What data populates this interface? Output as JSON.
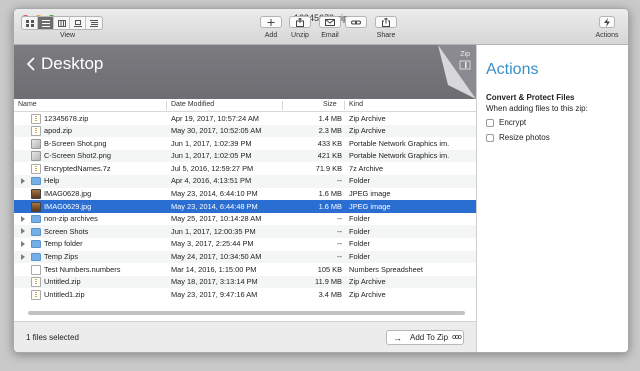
{
  "window": {
    "title": "12345678.zip"
  },
  "toolbar": {
    "view_label": "View",
    "add_label": "Add",
    "unzip_label": "Unzip",
    "email_label": "Email",
    "link_label": "",
    "share_label": "Share",
    "actions_label": "Actions"
  },
  "path": {
    "title": "Desktop",
    "archive_badge": "Zip"
  },
  "columns": {
    "name": "Name",
    "date": "Date Modified",
    "size": "Size",
    "kind": "Kind"
  },
  "files": [
    {
      "name": "12345678.zip",
      "date": "Apr 19, 2017, 10:57:24 AM",
      "size": "1.4 MB",
      "kind": "Zip Archive",
      "icon": "zip-icon",
      "expandable": false,
      "selected": false
    },
    {
      "name": "apod.zip",
      "date": "May 30, 2017, 10:52:05 AM",
      "size": "2.3 MB",
      "kind": "Zip Archive",
      "icon": "zip-icon",
      "expandable": false,
      "selected": false
    },
    {
      "name": "B-Screen Shot.png",
      "date": "Jun 1, 2017, 1:02:39 PM",
      "size": "433 KB",
      "kind": "Portable Network Graphics im.",
      "icon": "image-icon",
      "expandable": false,
      "selected": false
    },
    {
      "name": "C-Screen Shot2.png",
      "date": "Jun 1, 2017, 1:02:05 PM",
      "size": "421 KB",
      "kind": "Portable Network Graphics im.",
      "icon": "image-icon",
      "expandable": false,
      "selected": false
    },
    {
      "name": "EncryptedNames.7z",
      "date": "Jul 5, 2016, 12:59:27 PM",
      "size": "71.9 KB",
      "kind": "7z Archive",
      "icon": "zip-icon",
      "expandable": false,
      "selected": false
    },
    {
      "name": "Help",
      "date": "Apr 4, 2016, 4:13:51 PM",
      "size": "--",
      "kind": "Folder",
      "icon": "folder-icon",
      "expandable": true,
      "selected": false
    },
    {
      "name": "IMAG0628.jpg",
      "date": "May 23, 2014, 6:44:10 PM",
      "size": "1.6 MB",
      "kind": "JPEG image",
      "icon": "photo-icon",
      "expandable": false,
      "selected": false
    },
    {
      "name": "IMAG0629.jpg",
      "date": "May 23, 2014, 6:44:48 PM",
      "size": "1.6 MB",
      "kind": "JPEG image",
      "icon": "photo-icon",
      "expandable": false,
      "selected": true
    },
    {
      "name": "non-zip archives",
      "date": "May 25, 2017, 10:14:28 AM",
      "size": "--",
      "kind": "Folder",
      "icon": "folder-icon",
      "expandable": true,
      "selected": false
    },
    {
      "name": "Screen Shots",
      "date": "Jun 1, 2017, 12:00:35 PM",
      "size": "--",
      "kind": "Folder",
      "icon": "folder-icon",
      "expandable": true,
      "selected": false
    },
    {
      "name": "Temp folder",
      "date": "May 3, 2017, 2:25:44 PM",
      "size": "--",
      "kind": "Folder",
      "icon": "folder-icon",
      "expandable": true,
      "selected": false
    },
    {
      "name": "Temp Zips",
      "date": "May 24, 2017, 10:34:50 AM",
      "size": "--",
      "kind": "Folder",
      "icon": "folder-icon",
      "expandable": true,
      "selected": false
    },
    {
      "name": "Test Numbers.numbers",
      "date": "Mar 14, 2016, 1:15:00 PM",
      "size": "105 KB",
      "kind": "Numbers Spreadsheet",
      "icon": "document-icon",
      "expandable": false,
      "selected": false
    },
    {
      "name": "Untitled.zip",
      "date": "May 18, 2017, 3:13:14 PM",
      "size": "11.9 MB",
      "kind": "Zip Archive",
      "icon": "zip-icon",
      "expandable": false,
      "selected": false
    },
    {
      "name": "Untitled1.zip",
      "date": "May 23, 2017, 9:47:16 AM",
      "size": "3.4 MB",
      "kind": "Zip Archive",
      "icon": "zip-icon",
      "expandable": false,
      "selected": false
    }
  ],
  "footer": {
    "selection_count": "1 files selected",
    "add_button": "Add To Zip"
  },
  "panel": {
    "title": "Actions",
    "subtitle": "Convert & Protect Files",
    "note": "When adding files to this zip:",
    "options": [
      {
        "label": "Encrypt",
        "checked": false
      },
      {
        "label": "Resize photos",
        "checked": false
      }
    ]
  },
  "colors": {
    "selection": "#2a6ed2",
    "accent": "#3a8fc6",
    "pathbar": "#737378"
  }
}
